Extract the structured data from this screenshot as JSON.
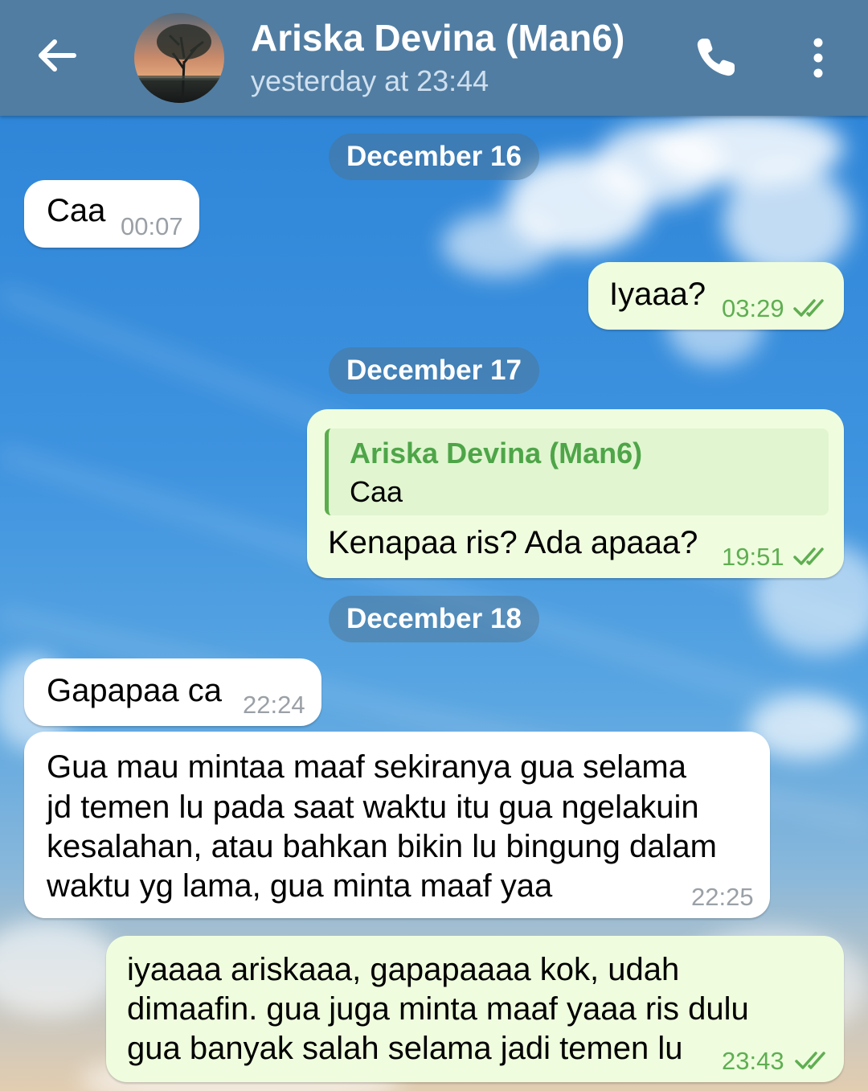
{
  "header": {
    "contact_name": "Ariska Devina (Man6)",
    "last_seen": "yesterday at 23:44"
  },
  "colors": {
    "header_bg": "#517DA2",
    "incoming_bubble": "#FFFFFF",
    "outgoing_bubble": "#EFFDDE",
    "outgoing_time": "#5FAE52",
    "reply_accent": "#4EA548"
  },
  "icons": {
    "back": "arrow-left-icon",
    "call": "phone-icon",
    "menu": "more-vertical-icon",
    "read_status": "double-check-icon"
  },
  "dates": [
    "December 16",
    "December 17",
    "December 18"
  ],
  "messages": [
    {
      "direction": "in",
      "text": "Caa",
      "time": "00:07"
    },
    {
      "direction": "out",
      "text": "Iyaaa?",
      "time": "03:29",
      "read": true
    },
    {
      "direction": "out",
      "reply_to": {
        "name": "Ariska Devina (Man6)",
        "text": "Caa"
      },
      "text": "Kenapaa ris? Ada apaaa?",
      "time": "19:51",
      "read": true
    },
    {
      "direction": "in",
      "text": "Gapapaa ca",
      "time": "22:24"
    },
    {
      "direction": "in",
      "lines": [
        "Gua mau mintaa maaf sekiranya gua selama",
        "jd temen lu pada saat waktu itu gua ngelakuin",
        "kesalahan, atau bahkan bikin lu bingung dalam",
        "waktu yg lama, gua minta maaf yaa"
      ],
      "time": "22:25"
    },
    {
      "direction": "out",
      "lines": [
        "iyaaaa ariskaaa, gapapaaaa kok, udah",
        "dimaafin. gua juga minta maaf yaaa ris dulu",
        "gua banyak salah selama jadi temen lu"
      ],
      "time": "23:43",
      "read": true
    }
  ]
}
